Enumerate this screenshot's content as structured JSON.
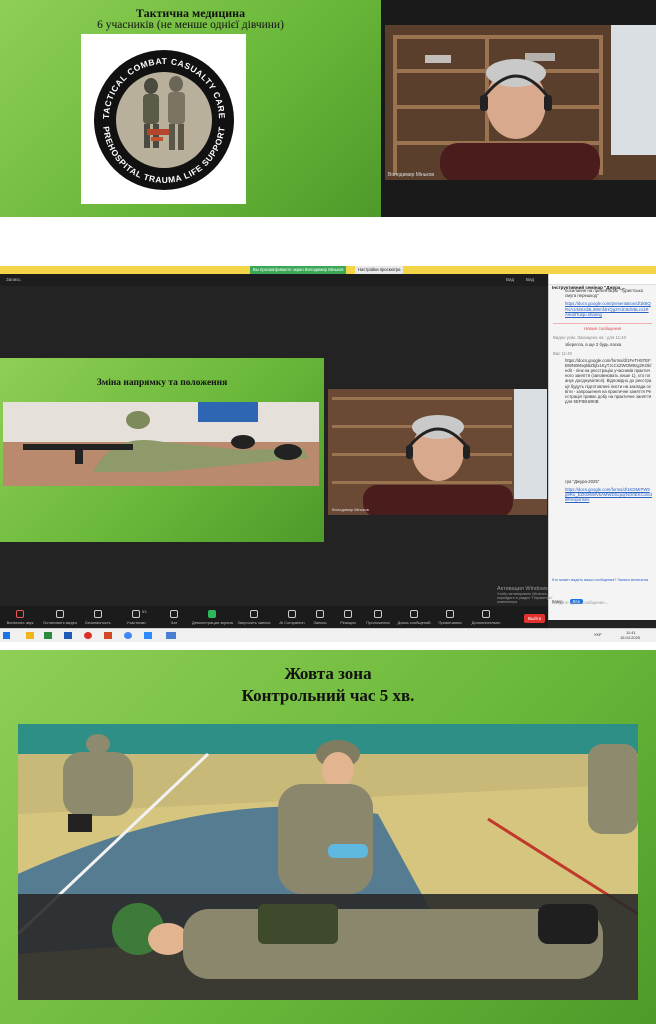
{
  "panel1": {
    "slide_title": "Тактична медицина",
    "slide_subtitle": "6 учасників (не менше однієї дівчини)",
    "badge_text_top": "TACTICAL COMBAT CASUALTY CARE",
    "badge_text_bottom": "PREHOSPITAL TRAUMA LIFE SUPPORT",
    "participant_name": "Володимир Міньков"
  },
  "panel2": {
    "tabs": [
      "Вы просматриваете экран Володимир Міньков",
      "Настройки просмотра"
    ],
    "top_left": "Запись",
    "top_right": [
      "Вид",
      "Вид"
    ],
    "slide_title": "Зміна напрямку та положення",
    "participant_name": "Володимир Міньков",
    "chat": {
      "title": "Інструктивний семінар \"Джура ...",
      "messages": [
        "посилання на презентацію \"Туристська смуга перешкод\"",
        "https://docs.google.com/presentation/d/1kBQRvA1rMXzd3L3Wmf4HQg3YdC9dVBLcs1RA/edit?usp=sharing",
        "Новые сообщения",
        "Видно усім. Захищено на : для 11:40",
        "зберегла, а ще  2 будь ласка",
        "Вас 11:40",
        "https://docs.google.com/forms/d/1FeTH5TEFBWN0Mvq65Zbjlx1KyTJcCsZWOM9zg2KOk/edit - лінк на реєстрацію учасників практичного заняття (заповнювать лише 1), хто планує доєднуватися). Відповідно до реєстрації будуть підготовлені листи на заклади освіти - запрошення на практичне заняття Реєстрація триває добу на практичне заняття для КЕРІВНИКІВ",
        "гра \"Джура-2025\"",
        "https://docs.google.com/forms/d/1KDMrPW9g9Ro_EZKt9hWVkAMWDScpqrNO0EKCo/edit#responses"
      ],
      "unread_note": "Кто может видеть ваши сообщения? Запись включена",
      "recipient_label": "Кому:",
      "recipient_value": "Все",
      "input_placeholder": "Введите здесь сообщение..."
    },
    "toolbar": [
      "Включить звук",
      "Остановить видео",
      "Безопасность",
      "Участники",
      "Чат",
      "Демонстрация экрана",
      "Запросить запись",
      "AI Companion",
      "Запись",
      "Реакции",
      "Приложения",
      "Доска сообщений",
      "Примечания",
      "Дополнительно"
    ],
    "participants_count": "63",
    "leave_label": "Выйти",
    "activation_line1": "Активация Windows",
    "activation_line2": "Чтобы активировать Windows, перейдите в раздел \"Параметры\"",
    "activation_line3": "компьютера",
    "clock_time": "11:41",
    "clock_date": "15.04.2025",
    "lang": "УКР"
  },
  "panel3": {
    "title_line1": "Жовта зона",
    "title_line2": "Контрольний час 5 хв."
  }
}
